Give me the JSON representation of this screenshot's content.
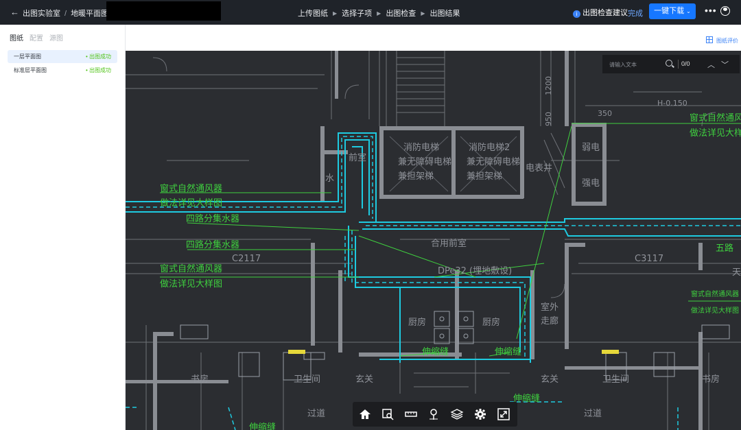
{
  "header": {
    "back_label": "出图实验室",
    "breadcrumb_current": "地暖平面图",
    "steps": [
      "上传图纸",
      "选择子项",
      "出图检查",
      "出图结果"
    ],
    "suggest_label": "出图检查建议",
    "done_label": "完成",
    "download_label": "一键下载"
  },
  "sidebar": {
    "tabs": [
      "图纸",
      "配置",
      "源图"
    ],
    "files": [
      {
        "name": "一层平面图",
        "status": "• 出图成功",
        "selected": true
      },
      {
        "name": "标准层平面图",
        "status": "• 出图成功",
        "selected": false
      }
    ]
  },
  "viewer": {
    "review_label": "图纸评价",
    "search": {
      "placeholder": "请输入文本",
      "count": "0/0"
    }
  },
  "drawing": {
    "labels_green": [
      "窗式自然通风器",
      "做法详见大样图",
      "四路分集水器",
      "四路分集水器",
      "窗式自然通风器",
      "做法详见大样图",
      "窗式自然通风器",
      "做法详见大样图",
      "五路",
      "伸缩缝",
      "伸缩缝",
      "伸缩缝",
      "伸缩缝"
    ],
    "labels_gray": [
      "消防电梯",
      "兼无障碍电梯",
      "兼担架梯",
      "消防电梯2",
      "兼无障碍电梯",
      "兼担架梯",
      "电表井",
      "弱电",
      "强电",
      "前室",
      "水",
      "合用前室",
      "C2117",
      "C3117",
      "厨房",
      "厨房",
      "室外",
      "走廊",
      "书房",
      "卫生间",
      "卫生间",
      "书房",
      "玄关",
      "玄关",
      "过道",
      "过道",
      "H-0.150",
      "350",
      "1200",
      "950",
      "DPe32 (埋地敷设)",
      "天"
    ],
    "colors": {
      "pipe": "#1ecbe1",
      "annotation": "#3fd13f",
      "wall": "#8a8d93",
      "background": "#2b2d31"
    }
  }
}
